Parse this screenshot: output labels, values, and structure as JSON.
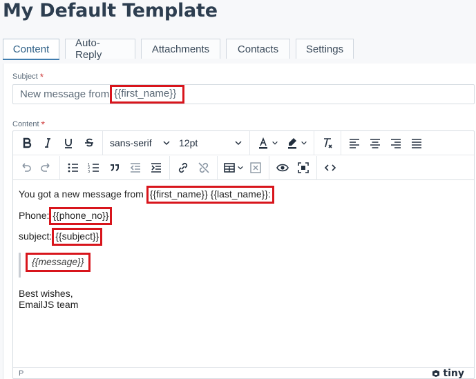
{
  "page": {
    "title": "My Default Template"
  },
  "tabs": [
    {
      "label": "Content",
      "active": true
    },
    {
      "label": "Auto-Reply",
      "active": false
    },
    {
      "label": "Attachments",
      "active": false
    },
    {
      "label": "Contacts",
      "active": false
    },
    {
      "label": "Settings",
      "active": false
    }
  ],
  "subject": {
    "label": "Subject",
    "required_mark": "*",
    "prefix": "New message from",
    "token": "{{first_name}}"
  },
  "content": {
    "label": "Content",
    "required_mark": "*"
  },
  "toolbar": {
    "font_family": "sans-serif",
    "font_size": "12pt",
    "row1_icons": [
      "bold-icon",
      "italic-icon",
      "underline-icon",
      "strikethrough-icon",
      "text-color-icon",
      "highlight-color-icon",
      "clear-formatting-icon",
      "align-left-icon",
      "align-center-icon",
      "align-right-icon",
      "align-justify-icon"
    ],
    "row2_icons": [
      "undo-icon",
      "redo-icon",
      "bullet-list-icon",
      "numbered-list-icon",
      "blockquote-icon",
      "outdent-icon",
      "indent-icon",
      "link-icon",
      "unlink-icon",
      "table-icon",
      "close-box-icon",
      "preview-icon",
      "fullscreen-icon",
      "source-code-icon"
    ]
  },
  "body": {
    "line1_prefix": "You got a new message from",
    "line1_tokens": "{{first_name}} {{last_name}}:",
    "phone_label": "Phone:",
    "phone_token": "{{phone_no}}",
    "subject_label": "subject:",
    "subject_token": "{{subject}}",
    "message_token": "{{message}}",
    "signoff1": "Best wishes,",
    "signoff2": "EmailJS team"
  },
  "statusbar": {
    "path": "P",
    "brand": "tiny"
  },
  "colors": {
    "highlight_red": "#d8151c",
    "active_tab": "#3f7cae",
    "required": "#d04040"
  }
}
